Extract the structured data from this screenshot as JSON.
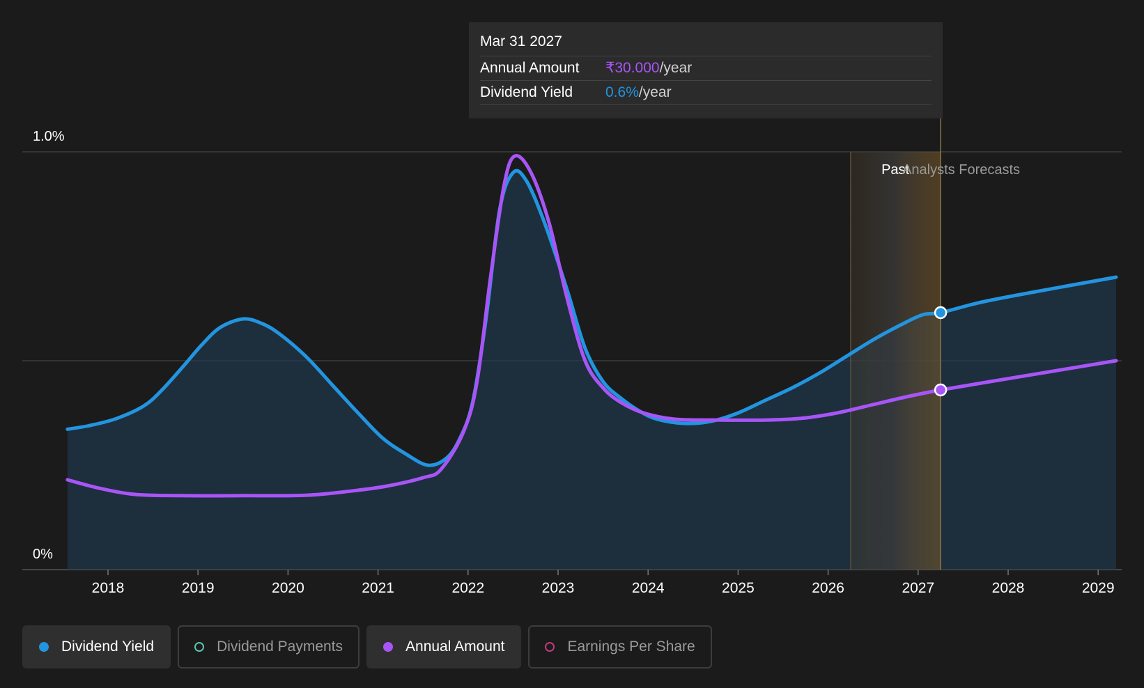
{
  "tooltip": {
    "date": "Mar 31 2027",
    "rows": [
      {
        "label": "Annual Amount",
        "value": "₹30.000",
        "unit": "/year",
        "color": "#a855f7"
      },
      {
        "label": "Dividend Yield",
        "value": "0.6%",
        "unit": "/year",
        "color": "#2394df"
      }
    ]
  },
  "legend": [
    {
      "label": "Dividend Yield",
      "color": "#2394df",
      "active": true,
      "filled": true
    },
    {
      "label": "Dividend Payments",
      "color": "#5ec4b0",
      "active": false,
      "filled": false
    },
    {
      "label": "Annual Amount",
      "color": "#a855f7",
      "active": true,
      "filled": true
    },
    {
      "label": "Earnings Per Share",
      "color": "#c23a7a",
      "active": false,
      "filled": false
    }
  ],
  "chart_data": {
    "type": "line",
    "y_tick_labels": [
      {
        "value": 1.0,
        "label": "1.0%"
      },
      {
        "value": 0,
        "label": "0%"
      }
    ],
    "ylim": [
      0,
      1.0
    ],
    "xlim": [
      2017.25,
      2029.2
    ],
    "x_ticks": [
      2018,
      2019,
      2020,
      2021,
      2022,
      2023,
      2024,
      2025,
      2026,
      2027,
      2028,
      2029
    ],
    "grid": true,
    "sections": {
      "past_label": "Past",
      "forecast_label": "Analysts Forecasts",
      "past_start": 2026.25,
      "hover_x": 2027.25
    },
    "series": [
      {
        "name": "Dividend Yield",
        "color": "#2394df",
        "area": true,
        "points": [
          [
            2017.55,
            0.336
          ],
          [
            2017.8,
            0.345
          ],
          [
            2018.1,
            0.362
          ],
          [
            2018.4,
            0.392
          ],
          [
            2018.6,
            0.43
          ],
          [
            2018.85,
            0.49
          ],
          [
            2019.05,
            0.54
          ],
          [
            2019.25,
            0.58
          ],
          [
            2019.5,
            0.6
          ],
          [
            2019.7,
            0.59
          ],
          [
            2019.9,
            0.565
          ],
          [
            2020.2,
            0.51
          ],
          [
            2020.5,
            0.44
          ],
          [
            2020.8,
            0.37
          ],
          [
            2021.05,
            0.315
          ],
          [
            2021.3,
            0.278
          ],
          [
            2021.55,
            0.25
          ],
          [
            2021.75,
            0.265
          ],
          [
            2021.9,
            0.31
          ],
          [
            2022.05,
            0.4
          ],
          [
            2022.2,
            0.6
          ],
          [
            2022.35,
            0.86
          ],
          [
            2022.5,
            0.95
          ],
          [
            2022.65,
            0.93
          ],
          [
            2022.85,
            0.83
          ],
          [
            2023.1,
            0.67
          ],
          [
            2023.3,
            0.53
          ],
          [
            2023.5,
            0.45
          ],
          [
            2023.7,
            0.41
          ],
          [
            2023.9,
            0.38
          ],
          [
            2024.1,
            0.36
          ],
          [
            2024.4,
            0.35
          ],
          [
            2024.7,
            0.355
          ],
          [
            2025.0,
            0.375
          ],
          [
            2025.3,
            0.405
          ],
          [
            2025.6,
            0.435
          ],
          [
            2025.9,
            0.47
          ],
          [
            2026.2,
            0.51
          ],
          [
            2026.5,
            0.55
          ],
          [
            2026.8,
            0.585
          ],
          [
            2027.05,
            0.61
          ],
          [
            2027.25,
            0.615
          ],
          [
            2027.7,
            0.64
          ],
          [
            2028.3,
            0.665
          ],
          [
            2029.2,
            0.7
          ]
        ]
      },
      {
        "name": "Annual Amount",
        "color": "#a855f7",
        "area": false,
        "points": [
          [
            2017.55,
            0.215
          ],
          [
            2017.9,
            0.195
          ],
          [
            2018.3,
            0.18
          ],
          [
            2018.8,
            0.177
          ],
          [
            2019.5,
            0.177
          ],
          [
            2020.2,
            0.178
          ],
          [
            2020.7,
            0.188
          ],
          [
            2021.1,
            0.2
          ],
          [
            2021.5,
            0.22
          ],
          [
            2021.7,
            0.24
          ],
          [
            2021.95,
            0.33
          ],
          [
            2022.1,
            0.45
          ],
          [
            2022.25,
            0.7
          ],
          [
            2022.4,
            0.92
          ],
          [
            2022.52,
            0.99
          ],
          [
            2022.7,
            0.95
          ],
          [
            2022.9,
            0.83
          ],
          [
            2023.1,
            0.65
          ],
          [
            2023.3,
            0.5
          ],
          [
            2023.5,
            0.435
          ],
          [
            2023.7,
            0.4
          ],
          [
            2023.95,
            0.375
          ],
          [
            2024.3,
            0.36
          ],
          [
            2024.8,
            0.358
          ],
          [
            2025.3,
            0.358
          ],
          [
            2025.7,
            0.362
          ],
          [
            2026.1,
            0.375
          ],
          [
            2026.5,
            0.395
          ],
          [
            2026.9,
            0.415
          ],
          [
            2027.25,
            0.43
          ],
          [
            2027.8,
            0.45
          ],
          [
            2028.5,
            0.475
          ],
          [
            2029.2,
            0.5
          ]
        ]
      }
    ],
    "highlight_points": [
      {
        "series": "Dividend Yield",
        "x": 2027.25,
        "y": 0.615
      },
      {
        "series": "Annual Amount",
        "x": 2027.25,
        "y": 0.43
      }
    ]
  }
}
